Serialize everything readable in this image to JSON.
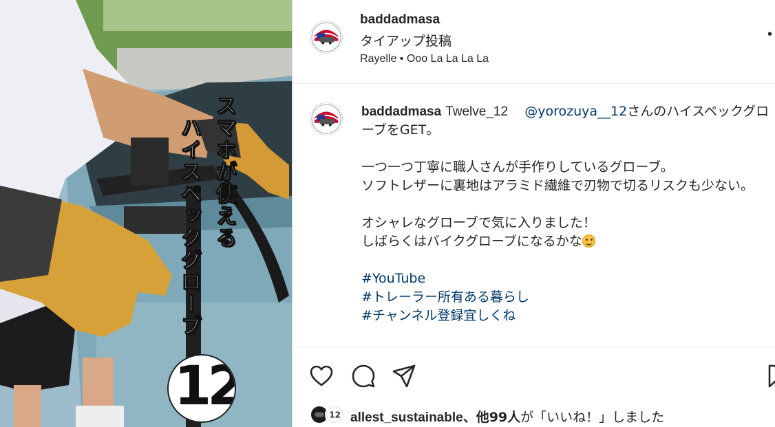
{
  "post": {
    "username": "baddadmasa",
    "subtitle": "タイアップ投稿",
    "audio": "Rayelle • Ooo La La La La",
    "more_label": "•"
  },
  "media": {
    "overlay_text_1": "スマホが使える",
    "overlay_text_2": "ハイスペックグローブ",
    "logo_text": "12"
  },
  "caption": {
    "username": "baddadmasa",
    "audio_name": "Twelve_12",
    "mention": "@yorozuya__12",
    "line1_rest": "さんのハイスペックグローブをGET。",
    "line2": "一つ一つ丁寧に職人さんが手作りしているグローブ。",
    "line3": "ソフトレザーに裏地はアラミド繊維で刃物で切るリスクも少ない。",
    "line4": "オシャレなグローブで気に入りました！",
    "line5": "しばらくはバイクグローブになるかな",
    "emoji": "smiling-face-emoji",
    "hashtags": [
      "#YouTube",
      "#トレーラー所有ある暮らし",
      "#チャンネル登録宜しくね"
    ]
  },
  "likes": {
    "first_user": "allest_sustainable",
    "others": "、他99人",
    "suffix": "が「いいね！」しました"
  },
  "icons": {
    "like": "heart-icon",
    "comment": "comment-icon",
    "share": "share-icon",
    "save": "bookmark-icon"
  }
}
